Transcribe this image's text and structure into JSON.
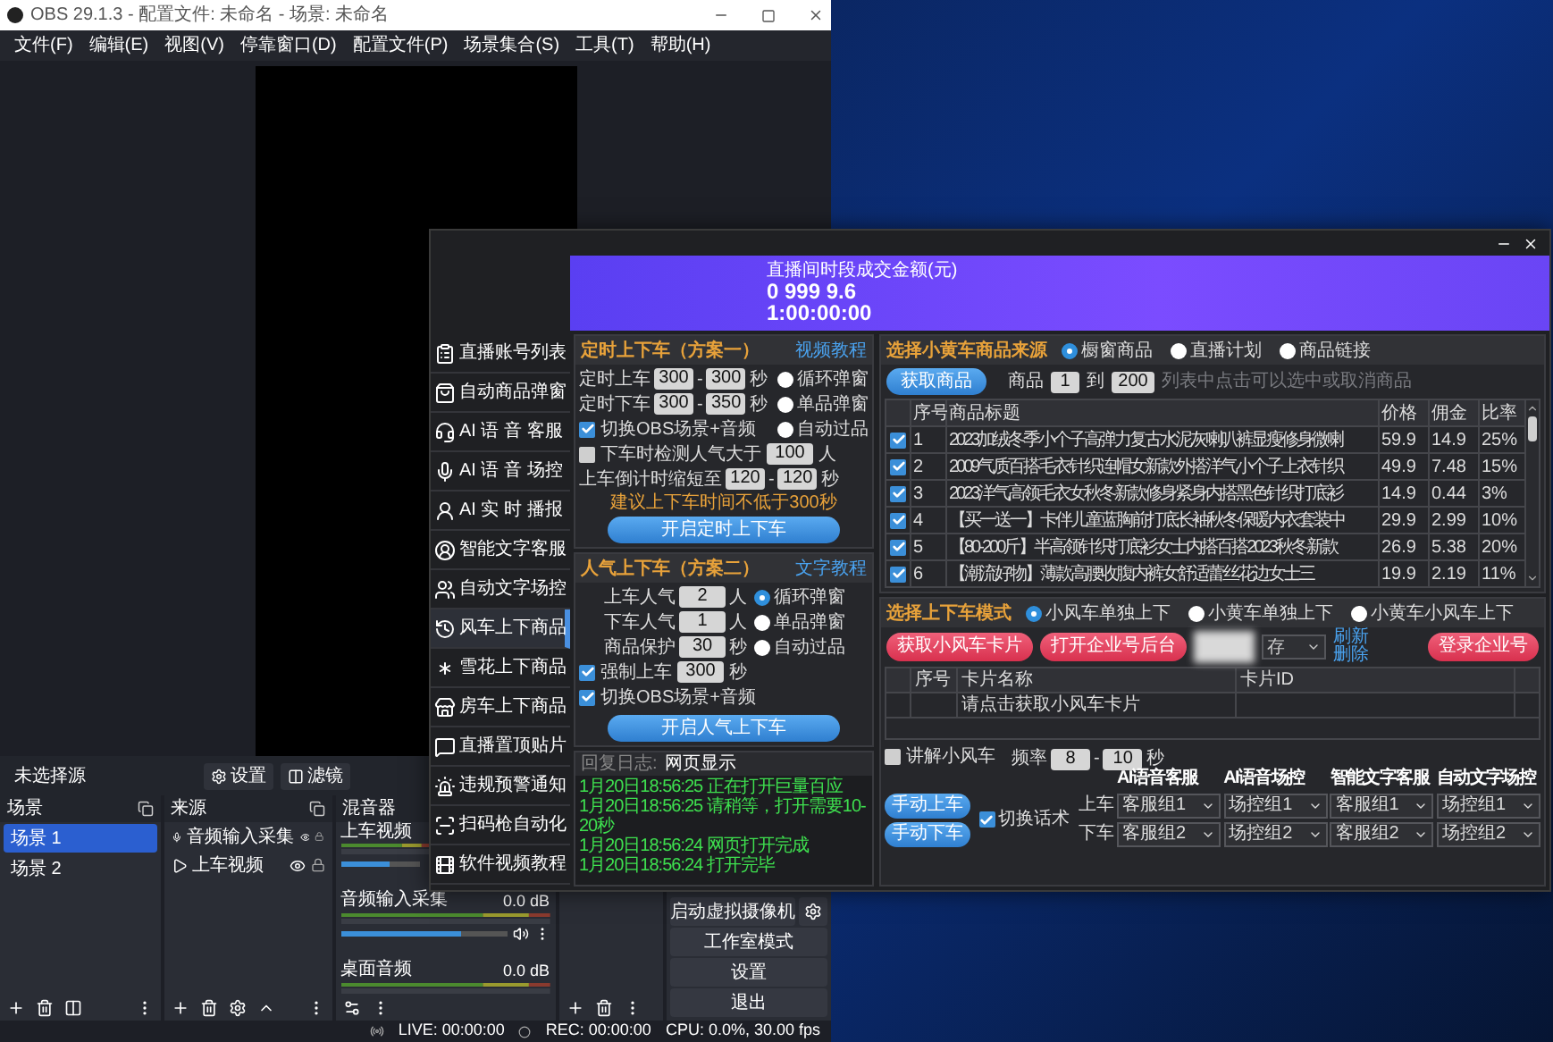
{
  "obs_window": {
    "title": "OBS 29.1.3 - 配置文件: 未命名 - 场景: 未命名",
    "menu": [
      "文件(F)",
      "编辑(E)",
      "视图(V)",
      "停靠窗口(D)",
      "配置文件(P)",
      "场景集合(S)",
      "工具(T)",
      "帮助(H)"
    ],
    "source_toolbar": {
      "label": "未选择源",
      "settings_button": "设置",
      "filters_button": "滤镜"
    },
    "scenes": {
      "title": "场景",
      "items": [
        {
          "label": "场景 1",
          "selected": true
        },
        {
          "label": "场景 2",
          "selected": false
        }
      ]
    },
    "sources": {
      "title": "来源",
      "items": [
        {
          "label": "音频输入采集",
          "kind": "audio"
        },
        {
          "label": "上车视频",
          "kind": "media"
        }
      ]
    },
    "mixer": {
      "title": "混音器",
      "channels": [
        {
          "name": "上车视频",
          "level": 0.62
        },
        {
          "name": "音频输入采集",
          "reading": "0.0 dB",
          "level": 0.72
        },
        {
          "name": "桌面音频",
          "reading": "0.0 dB"
        }
      ]
    },
    "controls": [
      "启动虚拟摄像机",
      "工作室模式",
      "设置",
      "退出"
    ],
    "status_bar": {
      "live": "LIVE: 00:00:00",
      "rec": "REC: 00:00:00",
      "cpu": "CPU: 0.0%, 30.00 fps"
    }
  },
  "tool_window": {
    "banner": {
      "caption": "直播间时段成交金额(元)",
      "figures": [
        "0 999 9.6",
        "1:00:00:00"
      ]
    },
    "nav": [
      {
        "label": "直播账号列表",
        "selected": false
      },
      {
        "label": "自动商品弹窗",
        "selected": false
      },
      {
        "label": "AI 语 音 客服",
        "selected": false
      },
      {
        "label": "AI 语 音 场控",
        "selected": false
      },
      {
        "label": "AI 实 时 播报",
        "selected": false
      },
      {
        "label": "智能文字客服",
        "selected": false
      },
      {
        "label": "自动文字场控",
        "selected": false
      },
      {
        "label": "风车上下商品",
        "selected": true
      },
      {
        "label": "雪花上下商品",
        "selected": false
      },
      {
        "label": "房车上下商品",
        "selected": false
      },
      {
        "label": "直播置顶贴片",
        "selected": false
      },
      {
        "label": "违规预警通知",
        "selected": false
      },
      {
        "label": "扫码枪自动化",
        "selected": false
      },
      {
        "label": "软件视频教程",
        "selected": false
      }
    ],
    "timed_panel": {
      "title": "定时上下车（方案一）",
      "link": "视频教程",
      "up": {
        "label": "定时上车",
        "min": "300",
        "dash": "-",
        "max": "300",
        "unit": "秒"
      },
      "down": {
        "label": "定时下车",
        "min": "300",
        "dash": "-",
        "max": "350",
        "unit": "秒"
      },
      "switch_obs": {
        "label": "切换OBS场景+音频",
        "checked": true
      },
      "check_popularity": {
        "label": "下车时检测人气大于",
        "checked": false,
        "value": "100",
        "unit": "人"
      },
      "countdown": {
        "label": "上车倒计时缩短至",
        "min": "120",
        "dash": "-",
        "max": "120",
        "unit": "秒"
      },
      "radios": [
        {
          "label": "循环弹窗",
          "selected": false
        },
        {
          "label": "单品弹窗",
          "selected": false
        },
        {
          "label": "自动过品",
          "selected": false
        }
      ],
      "hint": "建议上下车时间不低于300秒",
      "start_button": "开启定时上下车"
    },
    "popularity_panel": {
      "title": "人气上下车（方案二）",
      "link": "文字教程",
      "rows": [
        {
          "label": "上车人气",
          "value": "2",
          "unit": "人"
        },
        {
          "label": "下车人气",
          "value": "1",
          "unit": "人"
        },
        {
          "label": "商品保护",
          "value": "30",
          "unit": "秒"
        }
      ],
      "radios": [
        {
          "label": "循环弹窗",
          "selected": true
        },
        {
          "label": "单品弹窗",
          "selected": false
        },
        {
          "label": "自动过品",
          "selected": false
        }
      ],
      "force_up": {
        "label": "强制上车",
        "checked": true,
        "value": "300",
        "unit": "秒"
      },
      "switch_obs": {
        "label": "切换OBS场景+音频",
        "checked": true
      },
      "start_button": "开启人气上下车"
    },
    "log": {
      "tabs": [
        {
          "label": "回复日志:",
          "selected": false
        },
        {
          "label": "网页显示",
          "selected": true
        }
      ],
      "lines": [
        "1月20日18:56:25 正在打开巨量百应",
        "1月20日18:56:25 请稍等，打开需要10-20秒",
        "1月20日18:56:24 网页打开完成",
        "1月20日18:56:24 打开完毕"
      ]
    },
    "source_panel": {
      "title": "选择小黄车商品来源",
      "radios": [
        {
          "label": "橱窗商品",
          "selected": true
        },
        {
          "label": "直播计划",
          "selected": false
        },
        {
          "label": "商品链接",
          "selected": false
        }
      ],
      "fetch_button": "获取商品",
      "from_label": "商品",
      "from": "1",
      "to_label": "到",
      "to": "200",
      "hint": "列表中点击可以选中或取消商品",
      "table": {
        "columns": [
          "序号",
          "商品标题",
          "价格",
          "佣金",
          "比率"
        ],
        "rows": [
          {
            "checked": true,
            "cells": [
              "1",
              "2023加绒冬季小个子高弹力复古水泥灰喇叭裤显瘦修身微喇",
              "59.9",
              "14.9",
              "25%"
            ]
          },
          {
            "checked": true,
            "cells": [
              "2",
              "2009气质百搭毛衣针织连帽女新款外搭洋气小个子上衣针织",
              "49.9",
              "7.48",
              "15%"
            ]
          },
          {
            "checked": true,
            "cells": [
              "3",
              "2023洋气高领毛衣女秋冬新款修身紧身内搭黑色针织打底衫",
              "14.9",
              "0.44",
              "3%"
            ]
          },
          {
            "checked": true,
            "cells": [
              "4",
              "【买一送一】卡伴儿童蓝胸前打底长袖秋冬保暖内衣套装中",
              "29.9",
              "2.99",
              "10%"
            ]
          },
          {
            "checked": true,
            "cells": [
              "5",
              "【80-200斤】半高领针织打底衫女士内搭百搭2023秋冬新款",
              "26.9",
              "5.38",
              "20%"
            ]
          },
          {
            "checked": true,
            "cells": [
              "6",
              "【潮流好物】薄款高腰收腹内裤女舒适蕾丝花边女士三",
              "19.9",
              "2.19",
              "11%"
            ]
          }
        ]
      }
    },
    "mode_panel": {
      "title": "选择上下车模式",
      "radios": [
        {
          "label": "小风车单独上下",
          "selected": true
        },
        {
          "label": "小黄车单独上下",
          "selected": false
        },
        {
          "label": "小黄车小风车上下",
          "selected": false
        }
      ],
      "fetch_card_button": "获取小风车卡片",
      "open_backend_button": "打开企业号后台",
      "account_select": "存",
      "refresh_link": "刷新",
      "delete_link": "删除",
      "login_button": "登录企业号",
      "card_table": {
        "columns": [
          "序号",
          "卡片名称",
          "卡片ID"
        ],
        "rows": [
          {
            "name": "请点击获取小风车卡片"
          }
        ]
      },
      "explain": {
        "label": "讲解小风车",
        "checked": false
      },
      "frequency": {
        "label": "频率",
        "min": "8",
        "dash": "-",
        "max": "10",
        "unit": "秒"
      },
      "manual_up": "手动上车",
      "manual_down": "手动下车",
      "switch_script": {
        "label": "切换话术",
        "checked": true
      },
      "groups": {
        "columns": [
          "AI语音客服",
          "AI语音场控",
          "智能文字客服",
          "自动文字场控"
        ],
        "rows": [
          {
            "label": "上车",
            "values": [
              "客服组1",
              "场控组1",
              "客服组1",
              "场控组1"
            ]
          },
          {
            "label": "下车",
            "values": [
              "客服组2",
              "场控组2",
              "客服组2",
              "场控组2"
            ]
          }
        ]
      }
    }
  }
}
